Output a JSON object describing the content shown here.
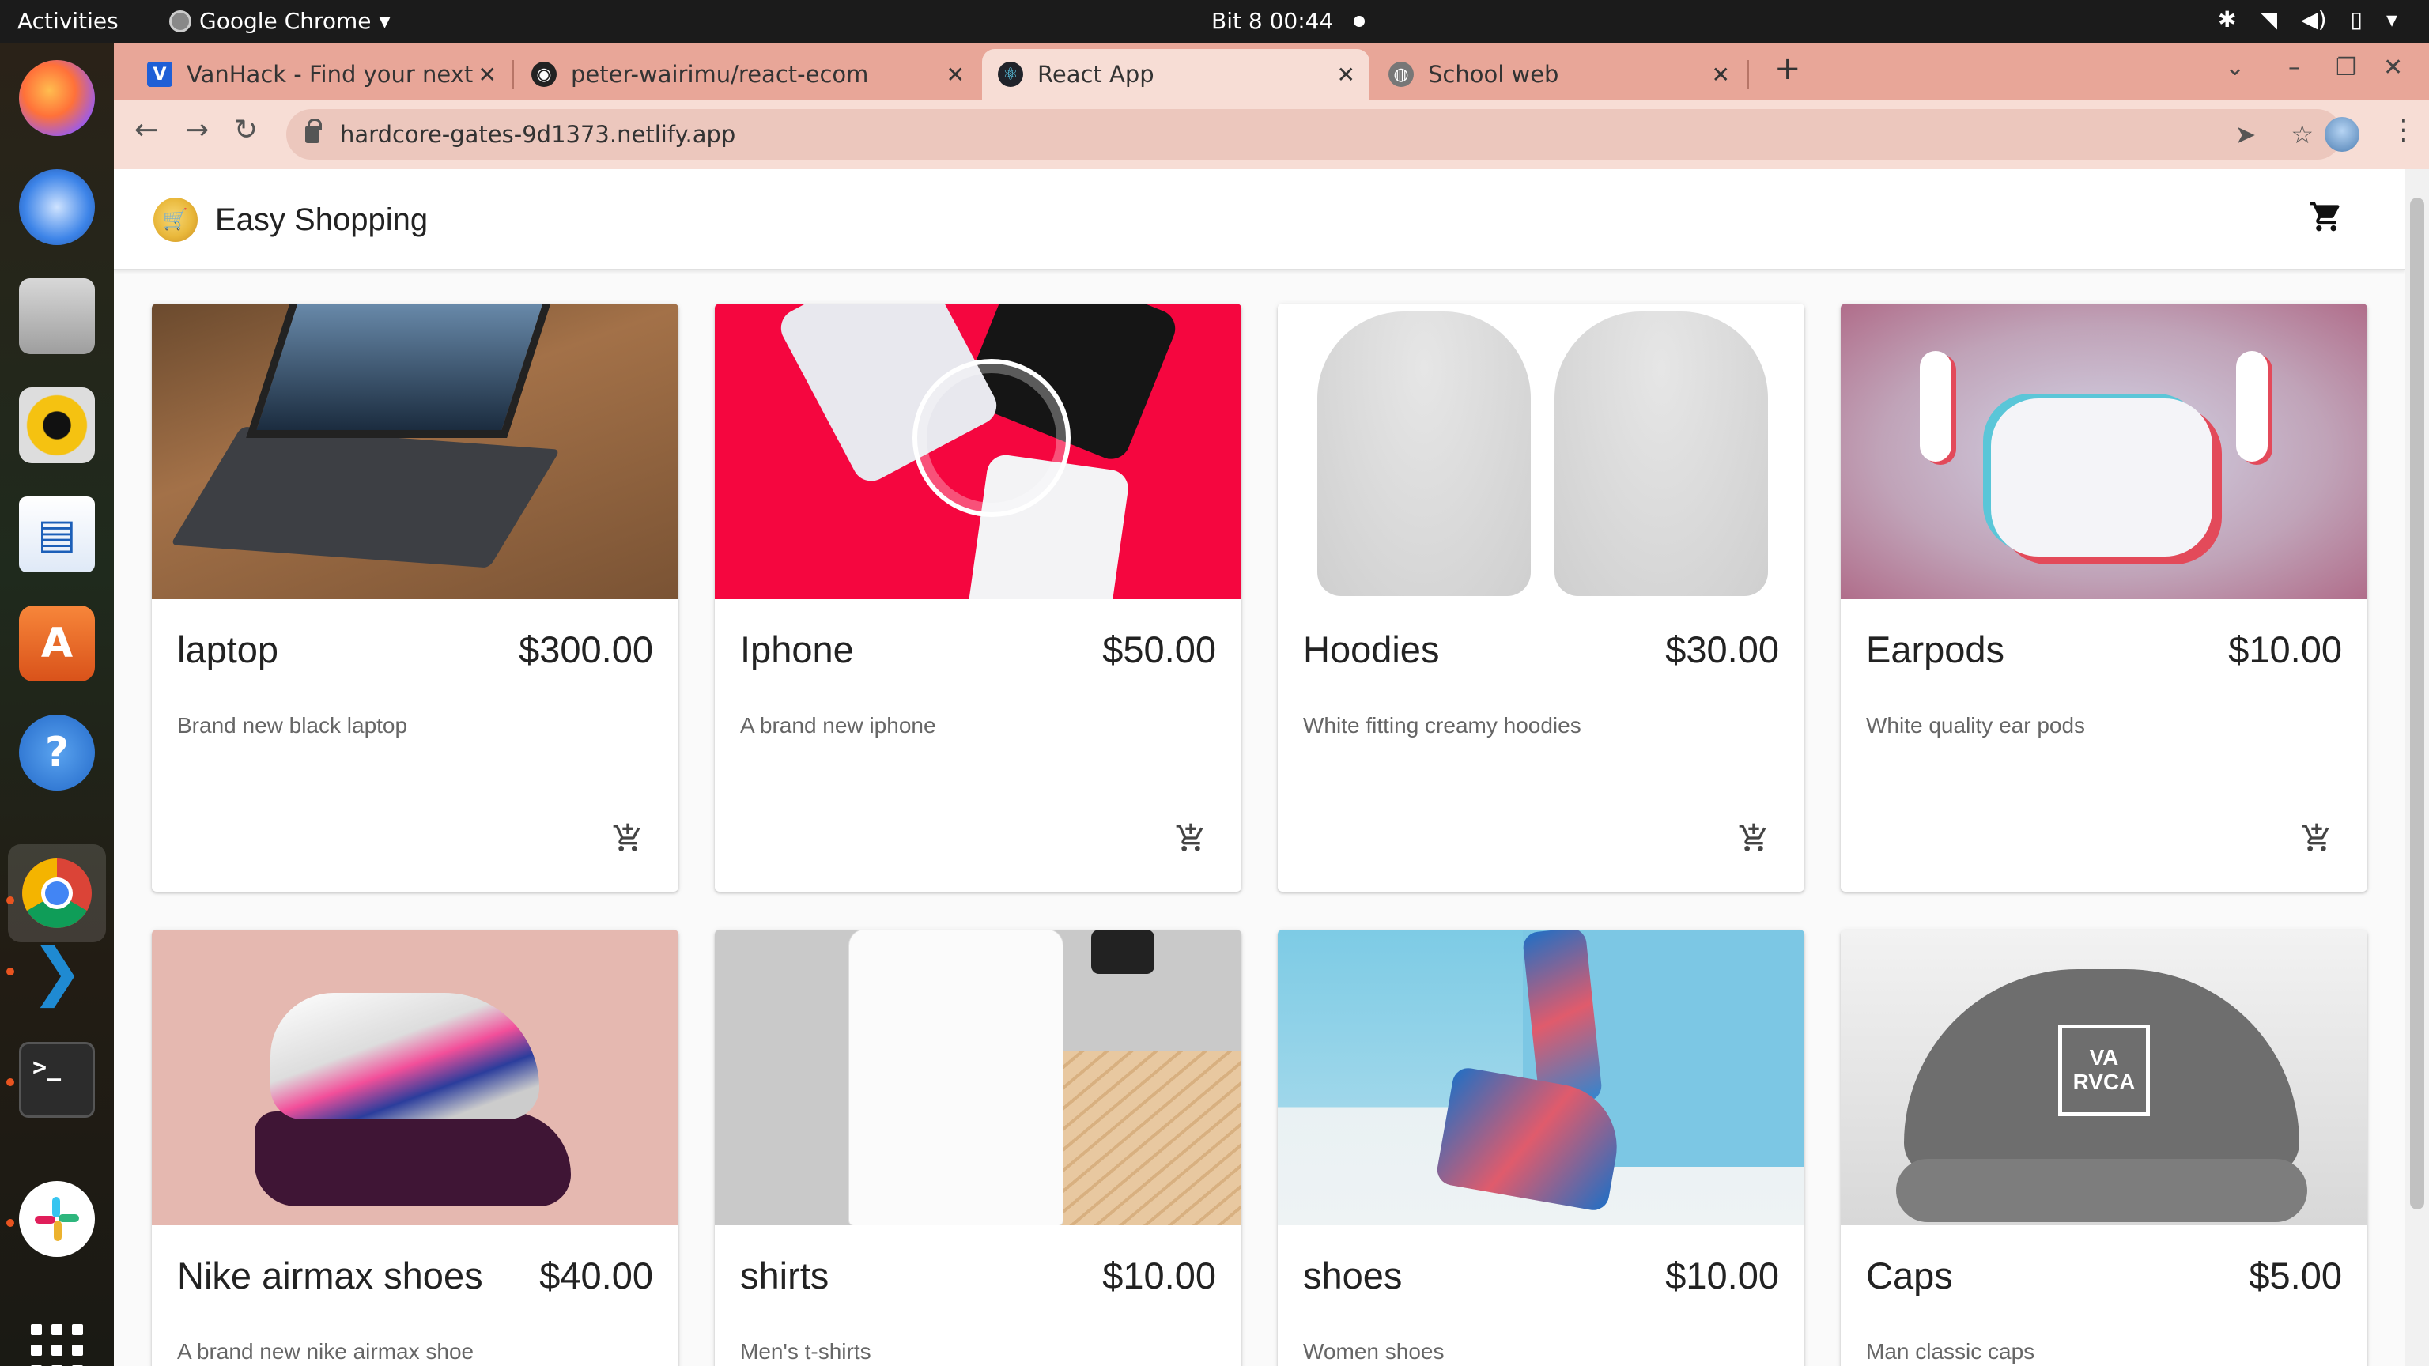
{
  "topbar": {
    "activities": "Activities",
    "app_name": "Google Chrome",
    "clock": "Bit 8  00:44"
  },
  "browser": {
    "tabs": [
      {
        "title": "VanHack - Find your next",
        "favicon": "vanhack-icon",
        "active": false
      },
      {
        "title": "peter-wairimu/react-ecom",
        "favicon": "github-icon",
        "active": false
      },
      {
        "title": "React App",
        "favicon": "react-icon",
        "active": true
      },
      {
        "title": "School web",
        "favicon": "globe-icon",
        "active": false
      }
    ],
    "url": "hardcore-gates-9d1373.netlify.app",
    "accent_color": "#e8a698"
  },
  "app": {
    "brand": "Easy Shopping"
  },
  "products": [
    {
      "name": "laptop",
      "price": "$300.00",
      "description": "Brand new black laptop"
    },
    {
      "name": "Iphone",
      "price": "$50.00",
      "description": "A brand new iphone"
    },
    {
      "name": "Hoodies",
      "price": "$30.00",
      "description": "White fitting creamy hoodies"
    },
    {
      "name": "Earpods",
      "price": "$10.00",
      "description": "White quality ear pods"
    },
    {
      "name": "Nike airmax shoes",
      "price": "$40.00",
      "description": "A brand new nike airmax shoe"
    },
    {
      "name": "shirts",
      "price": "$10.00",
      "description": "Men's t-shirts"
    },
    {
      "name": "shoes",
      "price": "$10.00",
      "description": "Women shoes"
    },
    {
      "name": "Caps",
      "price": "$5.00",
      "description": "Man classic caps"
    }
  ],
  "cap_patch": {
    "line1": "VA",
    "line2": "RVCA"
  }
}
